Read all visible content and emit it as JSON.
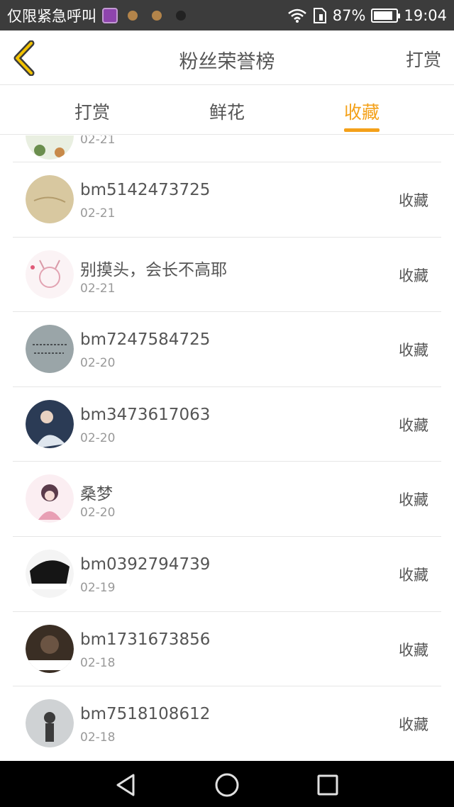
{
  "status_bar": {
    "carrier_text": "仅限紧急呼叫",
    "battery": "87%",
    "battery_level": 0.87,
    "time": "19:04",
    "icons": [
      "gallery-app-icon",
      "cookie-app-icon",
      "cookie-app-icon",
      "tiktok-app-icon",
      "wifi-icon",
      "sim-icon",
      "battery-icon"
    ]
  },
  "header": {
    "title": "粉丝荣誉榜",
    "action_label": "打赏",
    "back_icon": "chevron-left-icon"
  },
  "tabs": [
    {
      "label": "打赏",
      "active": false
    },
    {
      "label": "鲜花",
      "active": false
    },
    {
      "label": "收藏",
      "active": true
    }
  ],
  "accent_color": "#f4a11a",
  "partial_item": {
    "date": "02-21"
  },
  "items": [
    {
      "name": "bm5142473725",
      "date": "02-21",
      "action": "收藏"
    },
    {
      "name": "别摸头，会长不高耶",
      "date": "02-21",
      "action": "收藏"
    },
    {
      "name": "bm7247584725",
      "date": "02-20",
      "action": "收藏"
    },
    {
      "name": "bm3473617063",
      "date": "02-20",
      "action": "收藏"
    },
    {
      "name": "桑梦",
      "date": "02-20",
      "action": "收藏"
    },
    {
      "name": "bm0392794739",
      "date": "02-19",
      "action": "收藏"
    },
    {
      "name": "bm1731673856",
      "date": "02-18",
      "action": "收藏"
    },
    {
      "name": "bm7518108612",
      "date": "02-18",
      "action": "收藏"
    }
  ],
  "nav": {
    "back_icon": "triangle-back-icon",
    "home_icon": "circle-home-icon",
    "recents_icon": "square-recents-icon"
  }
}
